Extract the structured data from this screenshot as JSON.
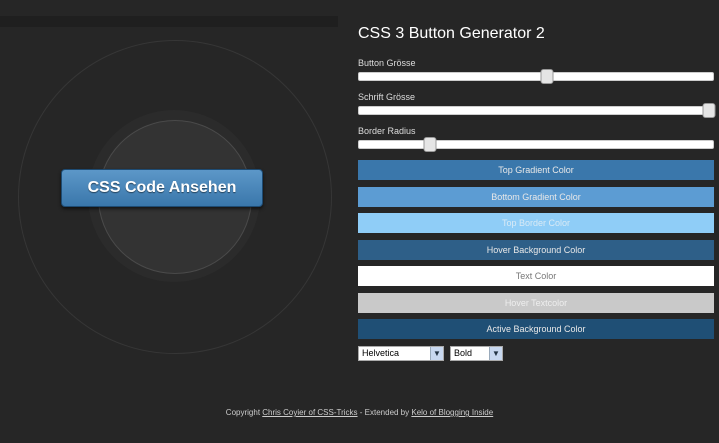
{
  "preview": {
    "button_label": "CSS Code Ansehen"
  },
  "panel": {
    "title": "CSS 3 Button Generator 2",
    "sliders": [
      {
        "label": "Button Grösse",
        "value": 0.53
      },
      {
        "label": "Schrift Grösse",
        "value": 0.99
      },
      {
        "label": "Border Radius",
        "value": 0.2
      }
    ],
    "color_buttons": [
      {
        "label": "Top Gradient Color",
        "bg": "#3a77ab",
        "fg": "#e8e8e8"
      },
      {
        "label": "Bottom Gradient Color",
        "bg": "#5c9cd3",
        "fg": "#e8e8e8"
      },
      {
        "label": "Top Border Color",
        "bg": "#8fcdf7",
        "fg": "#d9eaf5"
      },
      {
        "label": "Hover Background Color",
        "bg": "#2e5f88",
        "fg": "#e8e8e8"
      },
      {
        "label": "Text Color",
        "bg": "#ffffff",
        "fg": "#777777"
      },
      {
        "label": "Hover Textcolor",
        "bg": "#c9c9c9",
        "fg": "#eeeeee"
      },
      {
        "label": "Active Background Color",
        "bg": "#1f4f75",
        "fg": "#e8e8e8"
      }
    ],
    "font_select": {
      "value": "Helvetica"
    },
    "weight_select": {
      "value": "Bold"
    }
  },
  "footer": {
    "prefix": "Copyright ",
    "link1": "Chris Coyier of CSS-Tricks",
    "middle": " - Extended by ",
    "link2": "Kelo of Blogging Inside"
  }
}
